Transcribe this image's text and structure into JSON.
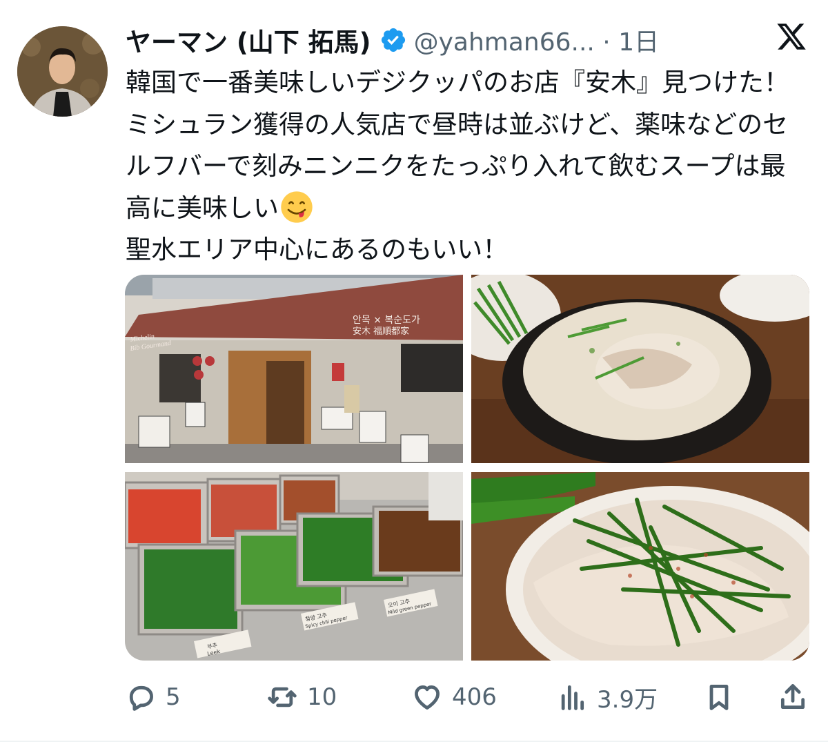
{
  "user": {
    "display_name": "ヤーマン (山下 拓馬)",
    "handle_time": "@yahman66... · 1日",
    "verified": true
  },
  "tweet": {
    "text": "韓国で一番美味しいデジクッパのお店『安木』見つけた！ミシュラン獲得の人気店で昼時は並ぶけど、薬味などのセルフバーで刻みニンニクをたっぷり入れて飲むスープは最高に美味しい",
    "emoji": "face-savoring-food",
    "text_line2": "聖水エリア中心にあるのもいい！"
  },
  "media": {
    "photo1": {
      "sign_korean": "안목 × 복순도가",
      "sign_kanji": "安木    福順都家",
      "awning_text1": "Michelin",
      "awning_text2": "Bib Gourmand"
    },
    "photo3": {
      "label1_ko": "부추",
      "label1_en": "Leek",
      "label2_ko": "청양 고추",
      "label2_en": "Spicy chili pepper",
      "label3_ko": "오이 고추",
      "label3_en": "Mild green pepper"
    }
  },
  "actions": {
    "replies": "5",
    "reposts": "10",
    "likes": "406",
    "views": "3.9万"
  },
  "colors": {
    "text": "#0f1419",
    "secondary": "#536471",
    "verified_blue": "#1d9bf0"
  }
}
